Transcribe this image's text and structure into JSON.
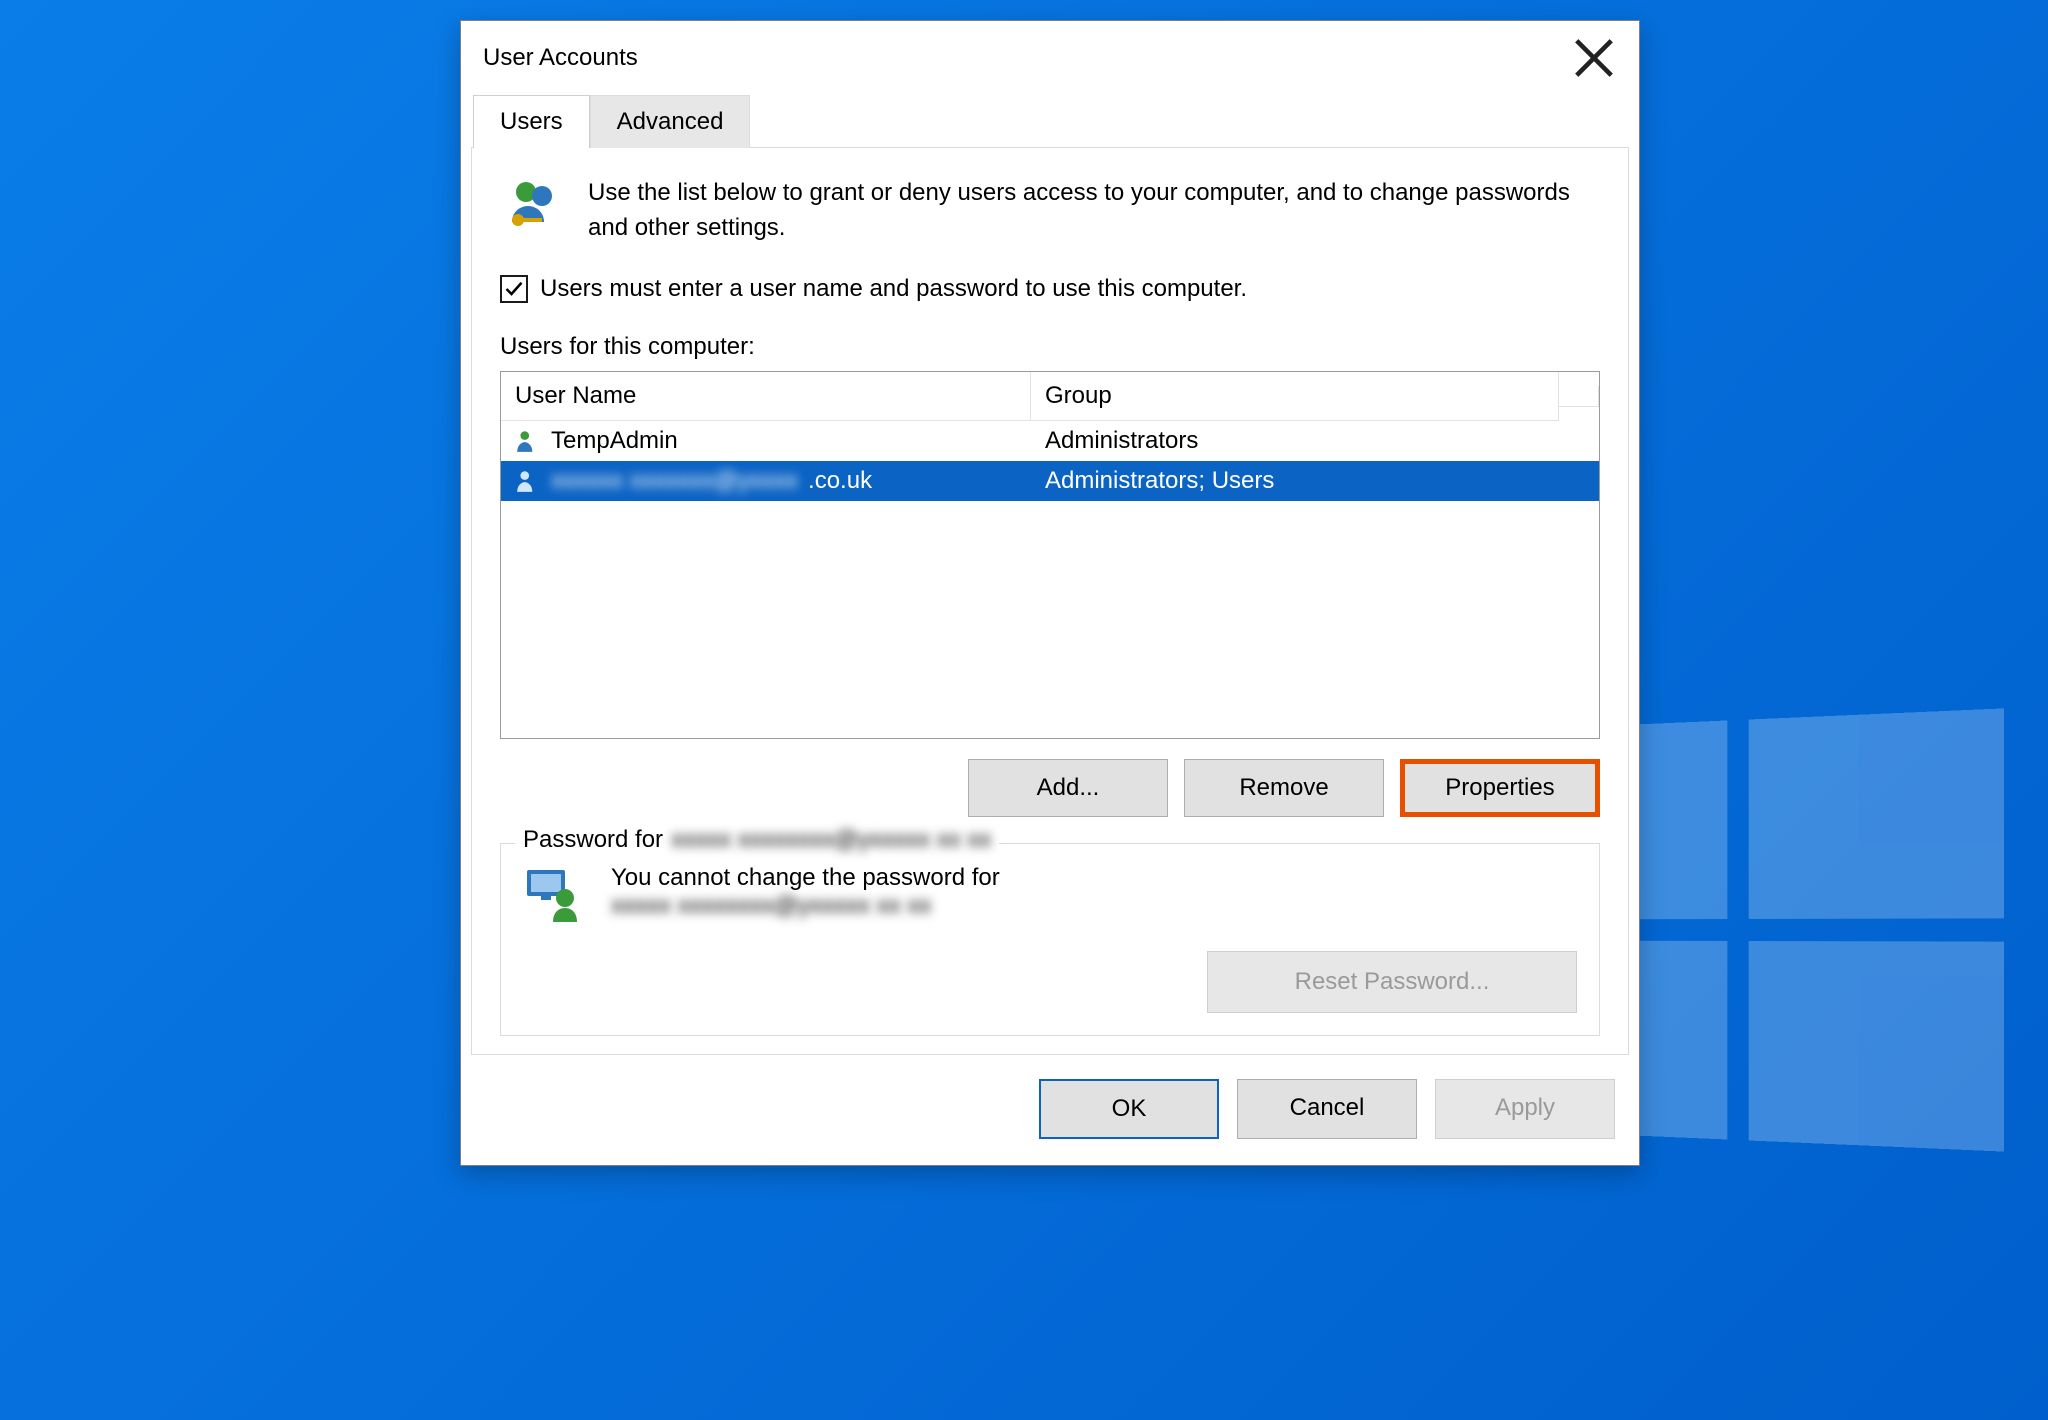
{
  "window": {
    "title": "User Accounts",
    "tabs": [
      {
        "label": "Users",
        "active": true
      },
      {
        "label": "Advanced",
        "active": false
      }
    ]
  },
  "intro": {
    "text": "Use the list below to grant or deny users access to your computer, and to change passwords and other settings."
  },
  "checkbox": {
    "checked": true,
    "label": "Users must enter a user name and password to use this computer."
  },
  "table": {
    "label": "Users for this computer:",
    "columns": [
      "User Name",
      "Group"
    ],
    "rows": [
      {
        "username": "TempAdmin",
        "group": "Administrators",
        "selected": false,
        "obscured": false
      },
      {
        "username": "████████@yahoo.co.uk",
        "group": "Administrators; Users",
        "selected": true,
        "obscured": true,
        "visible_suffix": ".co.uk"
      }
    ]
  },
  "row_buttons": {
    "add": "Add...",
    "remove": "Remove",
    "properties": "Properties"
  },
  "password_group": {
    "legend_prefix": "Password for",
    "legend_user_obscured": true,
    "cannot_change_text": "You cannot change the password for",
    "user_obscured": true,
    "reset_label": "Reset Password...",
    "reset_disabled": true
  },
  "footer": {
    "ok": "OK",
    "cancel": "Cancel",
    "apply": "Apply",
    "apply_disabled": true
  },
  "colors": {
    "selection": "#0b63c4",
    "highlight_border": "#e65100"
  }
}
